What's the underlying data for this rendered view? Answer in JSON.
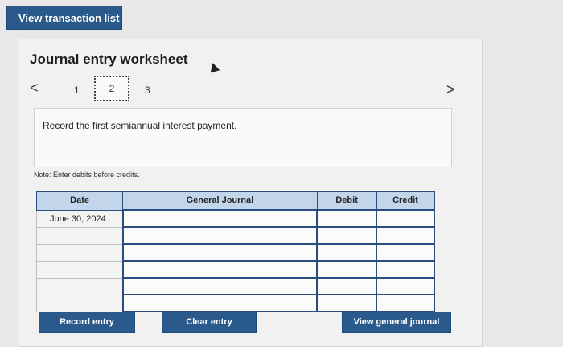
{
  "top_button": {
    "label": "View transaction list"
  },
  "worksheet": {
    "title": "Journal entry worksheet",
    "pages": [
      "1",
      "2",
      "3"
    ],
    "current_page": "2",
    "nav_prev": "<",
    "nav_next": ">",
    "instruction": "Record the first semiannual interest payment.",
    "note": "Note: Enter debits before credits."
  },
  "journal": {
    "headers": {
      "date": "Date",
      "general_journal": "General Journal",
      "debit": "Debit",
      "credit": "Credit"
    },
    "rows": [
      {
        "date": "June 30, 2024",
        "account": "",
        "debit": "",
        "credit": ""
      },
      {
        "date": "",
        "account": "",
        "debit": "",
        "credit": ""
      },
      {
        "date": "",
        "account": "",
        "debit": "",
        "credit": ""
      },
      {
        "date": "",
        "account": "",
        "debit": "",
        "credit": ""
      },
      {
        "date": "",
        "account": "",
        "debit": "",
        "credit": ""
      },
      {
        "date": "",
        "account": "",
        "debit": "",
        "credit": ""
      }
    ]
  },
  "actions": {
    "record": "Record entry",
    "clear": "Clear entry",
    "view_journal": "View general journal"
  }
}
